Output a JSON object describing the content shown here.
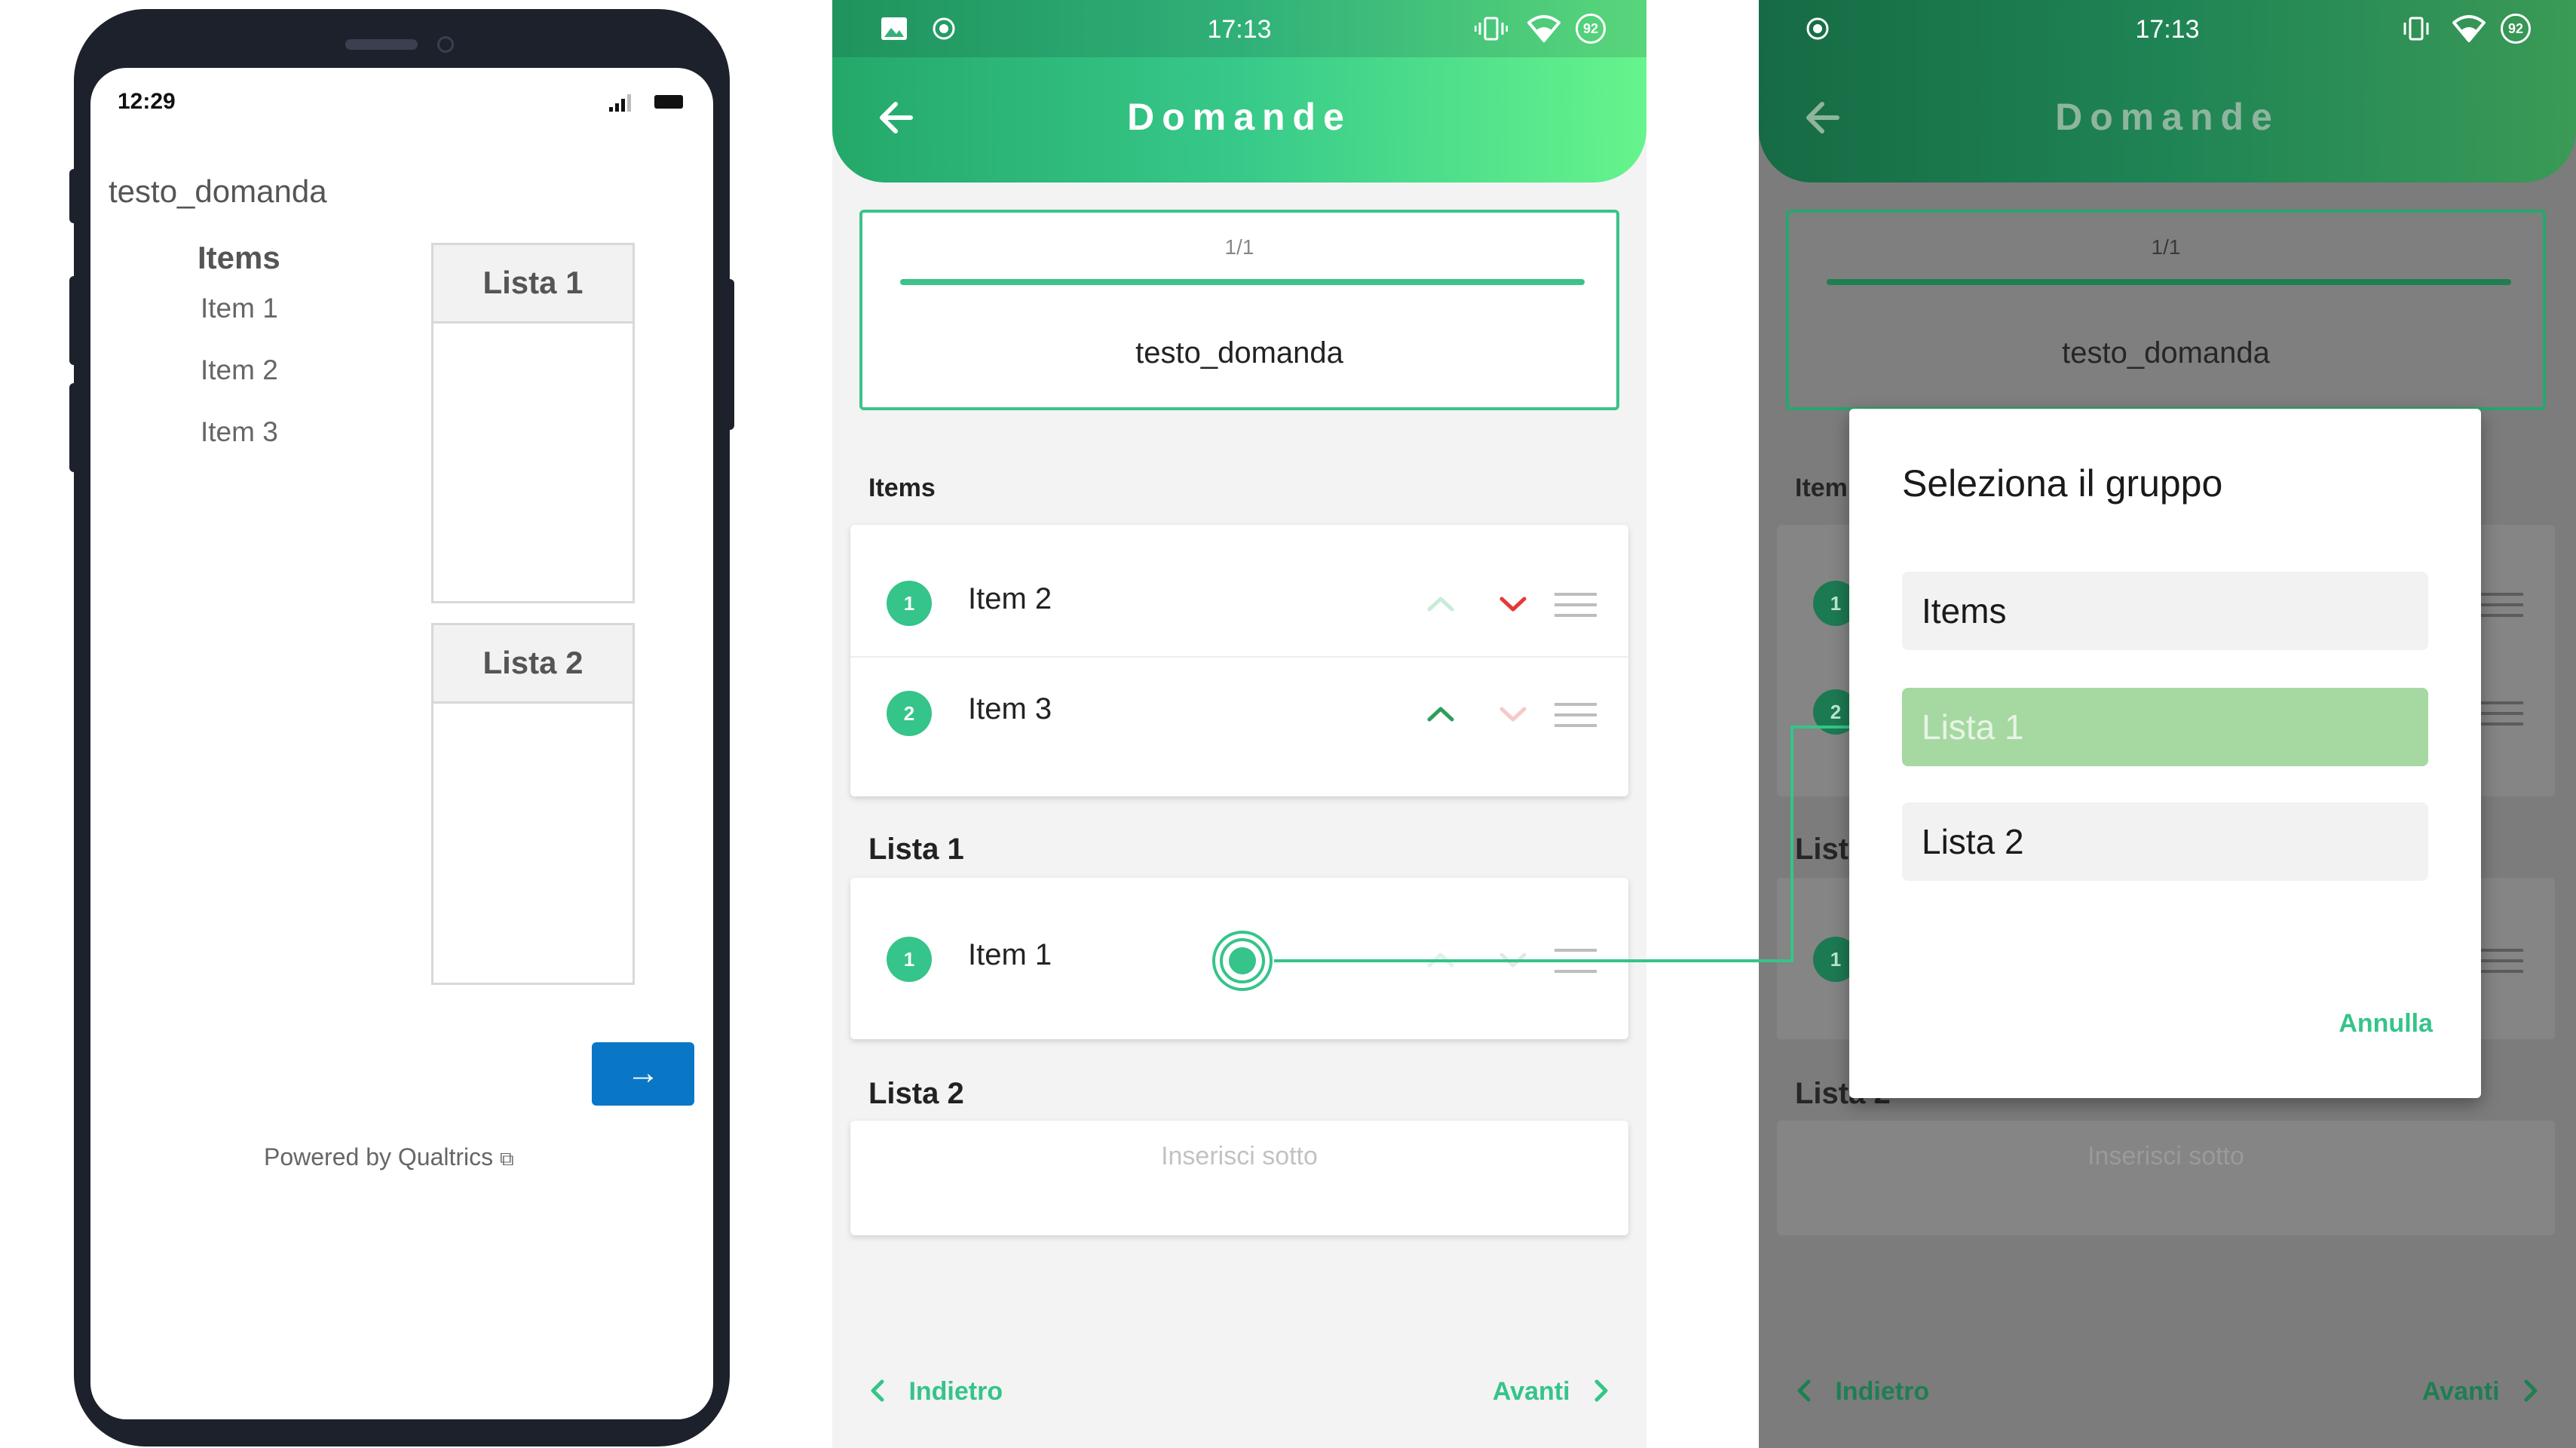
{
  "panel1": {
    "status_time": "12:29",
    "question": "testo_domanda",
    "items_title": "Items",
    "items": [
      "Item 1",
      "Item 2",
      "Item 3"
    ],
    "lists": [
      "Lista 1",
      "Lista 2"
    ],
    "next_label": "→",
    "powered_by": "Powered by Qualtrics"
  },
  "panel2": {
    "status_time": "17:13",
    "battery": "92",
    "title": "Domande",
    "counter": "1/1",
    "progress": 1.0,
    "question": "testo_domanda",
    "items_label": "Items",
    "items_rows": [
      {
        "badge": "1",
        "label": "Item 2"
      },
      {
        "badge": "2",
        "label": "Item 3"
      }
    ],
    "lista1_label": "Lista 1",
    "lista1_rows": [
      {
        "badge": "1",
        "label": "Item 1"
      }
    ],
    "lista2_label": "Lista 2",
    "empty_placeholder": "Inserisci sotto",
    "back_label": "Indietro",
    "next_label": "Avanti",
    "accent": "#35c489",
    "down_active_color": "#e53935"
  },
  "panel3": {
    "status_time": "17:13",
    "battery": "92",
    "title": "Domande",
    "counter": "1/1",
    "question": "testo_domanda",
    "items_label_partial": "Item",
    "lista1_partial": "List",
    "lista2_partial": "Lista 2",
    "empty_placeholder": "Inserisci sotto",
    "back_label": "Indietro",
    "next_label": "Avanti",
    "dialog": {
      "title": "Seleziona il gruppo",
      "options": [
        "Items",
        "Lista 1",
        "Lista 2"
      ],
      "selected": "Lista 1",
      "cancel": "Annulla"
    }
  }
}
